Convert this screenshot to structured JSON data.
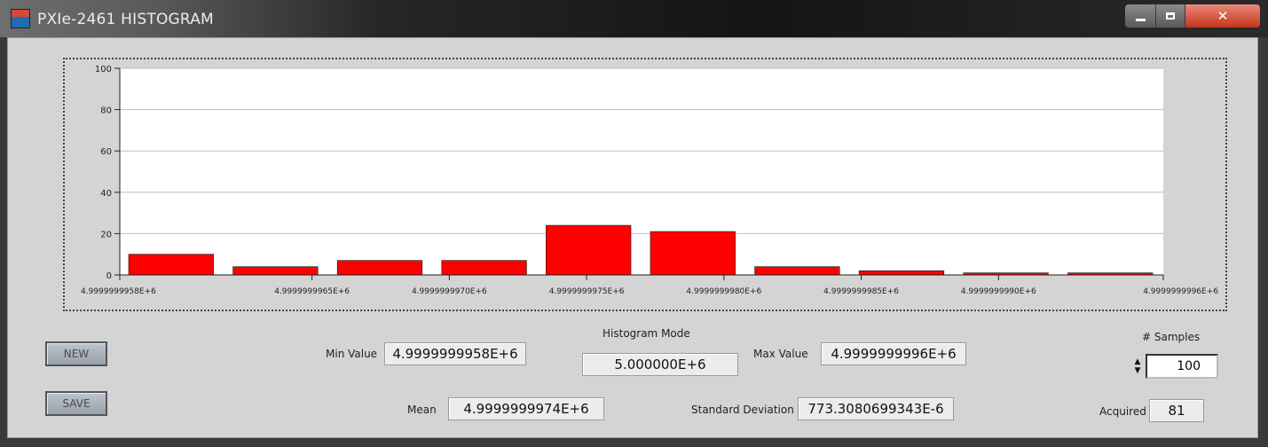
{
  "window": {
    "title": "PXIe-2461 HISTOGRAM"
  },
  "buttons": {
    "new": "NEW",
    "save": "SAVE"
  },
  "stats": {
    "min_label": "Min Value",
    "min_value": "4.9999999958E+6",
    "mode_label": "Histogram Mode",
    "mode_value": "5.000000E+6",
    "max_label": "Max Value",
    "max_value": "4.9999999996E+6",
    "mean_label": "Mean",
    "mean_value": "4.9999999974E+6",
    "std_label": "Standard Deviation",
    "std_value": "773.3080699343E-6"
  },
  "samples": {
    "label": "# Samples",
    "value": "100",
    "acquired_label": "Acquired",
    "acquired_value": "81"
  },
  "chart_data": {
    "type": "bar",
    "categories": [
      "4.9999999958E+6",
      "4.9999999962E+6",
      "4.9999999966E+6",
      "4.9999999969E+6",
      "4.9999999973E+6",
      "4.9999999977E+6",
      "4.9999999981E+6",
      "4.9999999985E+6",
      "4.9999999988E+6",
      "4.9999999992E+6"
    ],
    "values": [
      10,
      4,
      7,
      7,
      24,
      21,
      4,
      2,
      1,
      1
    ],
    "x_ticks": [
      "4.9999999958E+6",
      "4.9999999965E+6",
      "4.9999999970E+6",
      "4.9999999975E+6",
      "4.9999999980E+6",
      "4.9999999985E+6",
      "4.9999999990E+6",
      "4.9999999996E+6"
    ],
    "xlim": [
      4.9999999958,
      4.9999999996
    ],
    "y_ticks": [
      "0",
      "20",
      "40",
      "60",
      "80",
      "100"
    ],
    "ylim": [
      0,
      100
    ],
    "grid": true,
    "bar_color": "#ff0000"
  }
}
